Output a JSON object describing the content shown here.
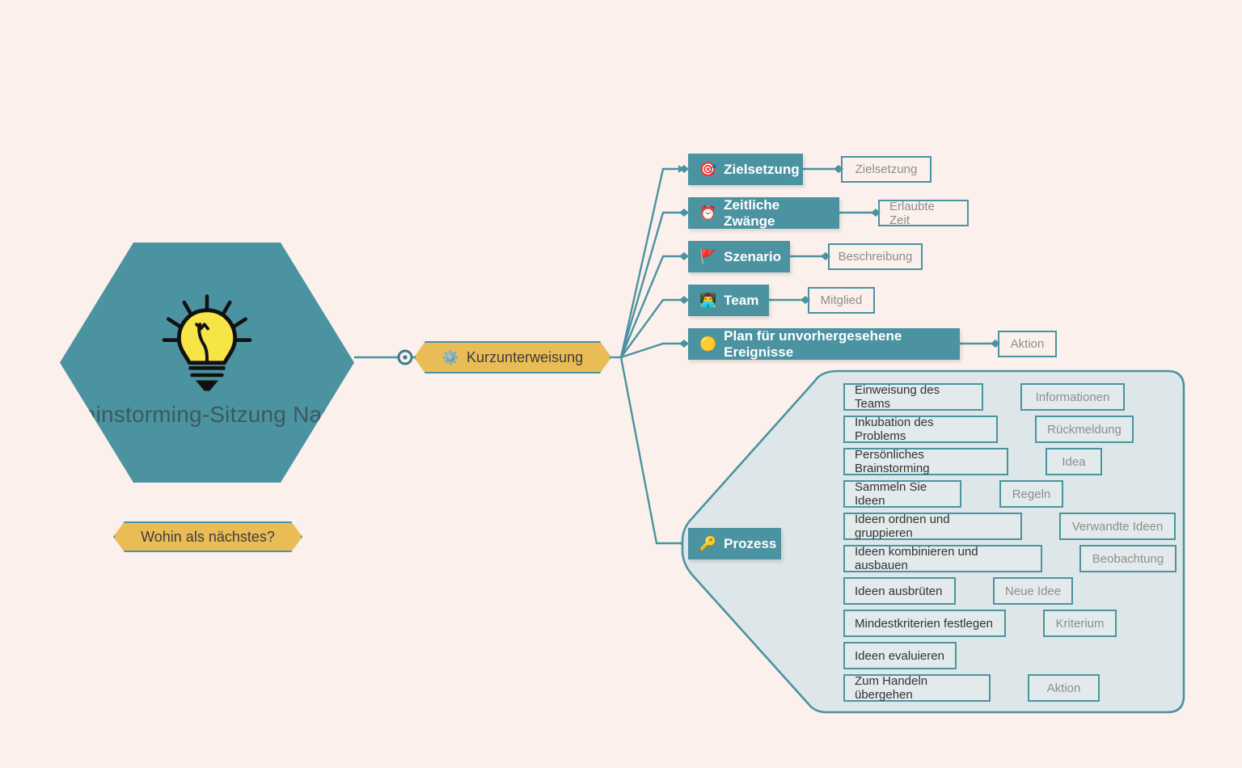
{
  "canvas": {
    "background_color": "#fbf0ec",
    "accent_teal": "#4b93a1",
    "accent_yellow": "#e9bc55",
    "group_fill": "#dde7e9",
    "leaf_text_color": "#8e8e8e",
    "root_text_color": "#3c5960"
  },
  "root": {
    "title": "Brainstorming-Sitzung Name",
    "icon": "lightbulb-icon"
  },
  "next_button": {
    "label": "Wohin als nächstes?"
  },
  "central_topic": {
    "label": "Kurzunterweisung",
    "icon": "gear-icon",
    "emoji": "⚙️"
  },
  "branches": [
    {
      "label": "Zielsetzung",
      "icon": "dart-target-icon",
      "emoji": "🎯",
      "child": "Zielsetzung"
    },
    {
      "label": "Zeitliche Zwänge",
      "icon": "alarm-clock-icon",
      "emoji": "⏰",
      "child": "Erlaubte Zeit"
    },
    {
      "label": "Szenario",
      "icon": "green-flag-icon",
      "emoji": "🚩",
      "child": "Beschreibung"
    },
    {
      "label": "Team",
      "icon": "person-at-laptop-icon",
      "emoji": "👨‍💻",
      "child": "Mitglied"
    },
    {
      "label": "Plan für unvorhergesehene Ereignisse",
      "icon": "yellow-circle-icon",
      "emoji": "🟡",
      "child": "Aktion"
    }
  ],
  "process": {
    "label": "Prozess",
    "icon": "key-icon",
    "emoji": "🔑",
    "steps": [
      {
        "label": "Einweisung des Teams",
        "child": "Informationen"
      },
      {
        "label": "Inkubation des Problems",
        "child": "Rückmeldung"
      },
      {
        "label": "Persönliches Brainstorming",
        "child": "Idea"
      },
      {
        "label": "Sammeln Sie Ideen",
        "child": "Regeln"
      },
      {
        "label": "Ideen ordnen und gruppieren",
        "child": "Verwandte Ideen"
      },
      {
        "label": "Ideen kombinieren und ausbauen",
        "child": "Beobachtung"
      },
      {
        "label": "Ideen ausbrüten",
        "child": "Neue Idee"
      },
      {
        "label": "Mindestkriterien festlegen",
        "child": "Kriterium"
      },
      {
        "label": "Ideen evaluieren",
        "child": null
      },
      {
        "label": "Zum Handeln übergehen",
        "child": "Aktion"
      }
    ]
  }
}
